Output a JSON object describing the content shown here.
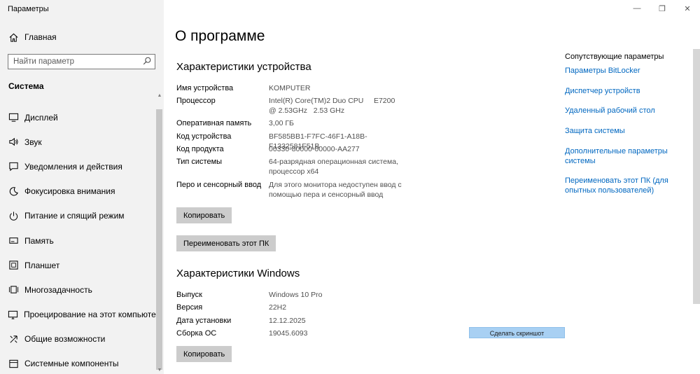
{
  "window": {
    "title": "Параметры",
    "controls": {
      "minimize": "—",
      "maximize": "❐",
      "close": "✕"
    }
  },
  "sidebar": {
    "home_label": "Главная",
    "search": {
      "placeholder": "Найти параметр"
    },
    "section_title": "Система",
    "items": [
      {
        "label": "Дисплей",
        "icon": "display-icon"
      },
      {
        "label": "Звук",
        "icon": "sound-icon"
      },
      {
        "label": "Уведомления и действия",
        "icon": "notifications-icon"
      },
      {
        "label": "Фокусировка внимания",
        "icon": "focus-assist-icon"
      },
      {
        "label": "Питание и спящий режим",
        "icon": "power-icon"
      },
      {
        "label": "Память",
        "icon": "storage-icon"
      },
      {
        "label": "Планшет",
        "icon": "tablet-icon"
      },
      {
        "label": "Многозадачность",
        "icon": "multitasking-icon"
      },
      {
        "label": "Проецирование на этот компьютер",
        "icon": "projecting-icon"
      },
      {
        "label": "Общие возможности",
        "icon": "shared-experiences-icon"
      },
      {
        "label": "Системные компоненты",
        "icon": "system-components-icon"
      }
    ]
  },
  "main": {
    "title": "О программе",
    "device": {
      "heading": "Характеристики устройства",
      "rows": [
        {
          "label": "Имя устройства",
          "value": "KOMPUTER"
        },
        {
          "label": "Процессор",
          "value": "Intel(R) Core(TM)2 Duo CPU     E7200  @ 2.53GHz   2.53 GHz"
        },
        {
          "label": "Оперативная память",
          "value": "3,00 ГБ"
        },
        {
          "label": "Код устройства",
          "value": "BF585BB1-F7FC-46F1-A18B-F1332581F51B"
        },
        {
          "label": "Код продукта",
          "value": "00330-80000-00000-AA277"
        },
        {
          "label": "Тип системы",
          "value": "64-разрядная операционная система, процессор x64"
        },
        {
          "label": "Перо и сенсорный ввод",
          "value": "Для этого монитора недоступен ввод с помощью пера и сенсорный ввод"
        }
      ],
      "copy_button": "Копировать",
      "rename_button": "Переименовать этот ПК"
    },
    "windows": {
      "heading": "Характеристики Windows",
      "rows": [
        {
          "label": "Выпуск",
          "value": "Windows 10 Pro"
        },
        {
          "label": "Версия",
          "value": "22H2"
        },
        {
          "label": "Дата установки",
          "value": "12.12.2025"
        },
        {
          "label": "Сборка ОС",
          "value": "19045.6093"
        }
      ],
      "copy_button": "Копировать"
    },
    "screenshot_button": "Сделать скриншот"
  },
  "related": {
    "heading": "Сопутствующие параметры",
    "links": [
      "Параметры BitLocker",
      "Диспетчер устройств",
      "Удаленный рабочий стол",
      "Защита системы",
      "Дополнительные параметры системы",
      "Переименовать этот ПК (для опытных пользователей)"
    ]
  },
  "colors": {
    "accent_link": "#0067c0",
    "sidebar_bg": "#f2f2f2",
    "button_bg": "#cccccc",
    "screenshot_button_bg": "#a8d0f3"
  }
}
